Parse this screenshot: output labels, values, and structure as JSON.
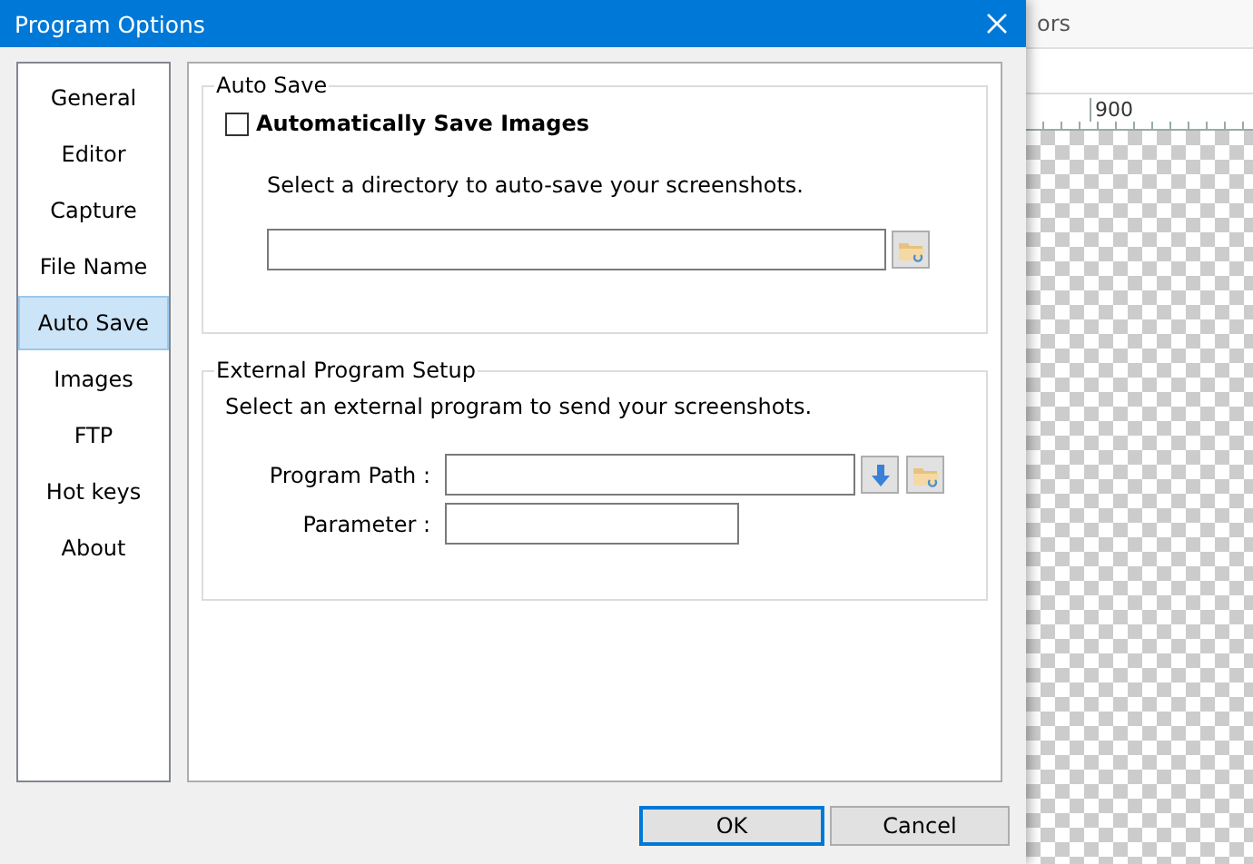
{
  "background_app": {
    "menu_text": "ors",
    "ruler_label": "900"
  },
  "window": {
    "title": "Program Options"
  },
  "sidebar": {
    "items": [
      {
        "label": "General",
        "selected": false
      },
      {
        "label": "Editor",
        "selected": false
      },
      {
        "label": "Capture",
        "selected": false
      },
      {
        "label": "File Name",
        "selected": false
      },
      {
        "label": "Auto Save",
        "selected": true
      },
      {
        "label": "Images",
        "selected": false
      },
      {
        "label": "FTP",
        "selected": false
      },
      {
        "label": "Hot keys",
        "selected": false
      },
      {
        "label": "About",
        "selected": false
      }
    ]
  },
  "auto_save": {
    "title": "Auto Save",
    "checkbox": {
      "label": "Automatically Save Images",
      "checked": false
    },
    "description": "Select a directory to auto-save your screenshots."
  },
  "external_program": {
    "title": "External Program Setup",
    "description": "Select an external program to send your screenshots.",
    "program_path_label": "Program Path :",
    "parameter_label": "Parameter :"
  },
  "buttons": [
    {
      "label": "OK",
      "kind": "default"
    },
    {
      "label": "Cancel",
      "kind": "normal"
    }
  ]
}
